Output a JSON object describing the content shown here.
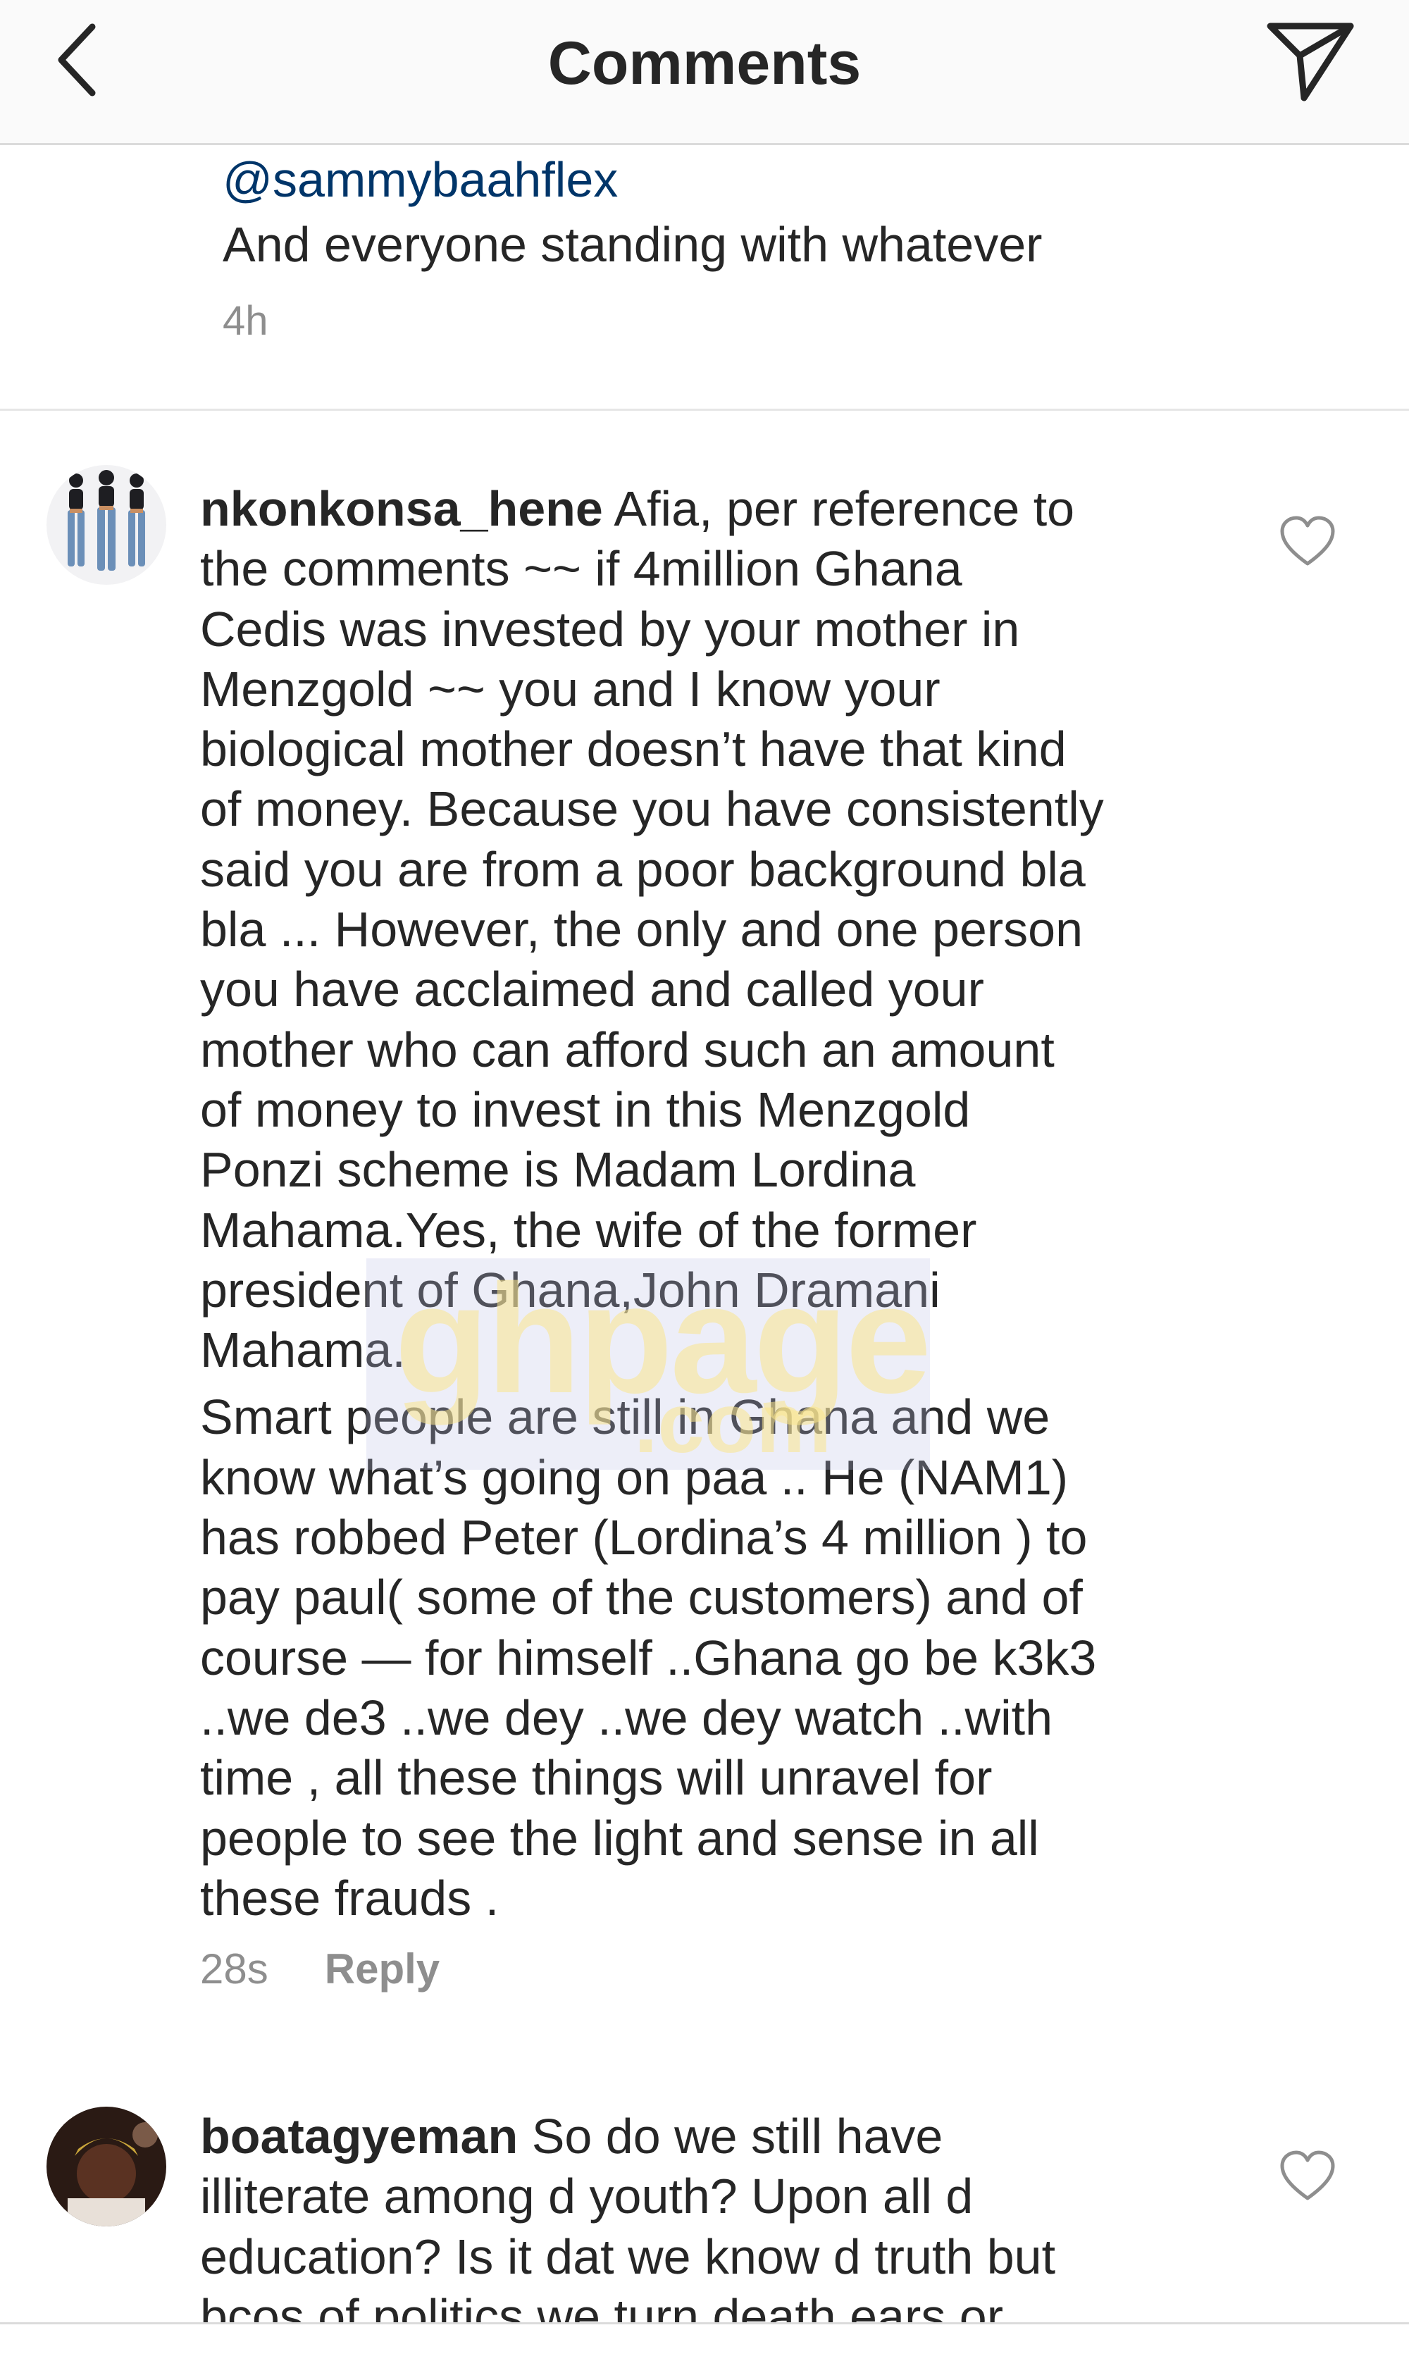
{
  "header": {
    "title": "Comments",
    "back_icon": "chevron-left-icon",
    "send_icon": "paper-plane-icon"
  },
  "previous_comment": {
    "mention": "@sammybaahflex",
    "text": "And everyone standing  with whatever",
    "time": "4h"
  },
  "comments": [
    {
      "username": "nkonkonsa_hene",
      "lines": [
        "Afia, per reference to",
        "the comments ~~ if 4million Ghana",
        "Cedis was invested by your mother in",
        "Menzgold ~~ you and I know your",
        "biological mother doesn’t have that kind",
        "of money. Because you have consistently",
        "said you are from a poor background bla",
        "bla ... However, the only and one person",
        "you have acclaimed and called your",
        "mother who can afford such an amount",
        "of money to invest in this Menzgold",
        "Ponzi scheme is Madam Lordina",
        "Mahama.Yes, the wife of the former",
        "president of Ghana,John Dramani",
        "Mahama."
      ],
      "lines2": [
        "Smart people are still in Ghana and we",
        "know what’s going on paa .. He (NAM1)",
        "has robbed Peter (Lordina’s 4 million ) to",
        "pay paul( some of the customers) and of",
        "course — for himself ..Ghana go be k3k3",
        "..we de3 ..we dey ..we dey watch ..with",
        "time , all these things will unravel for",
        "people to see the light and sense in all",
        "these frauds ."
      ],
      "time": "28s",
      "reply_label": "Reply"
    },
    {
      "username": "boatagyeman",
      "lines": [
        "So do we still have",
        "illiterate among d youth? Upon all d",
        "education? Is it dat we know d truth but",
        "bcos of politics we turn death ears or"
      ]
    }
  ],
  "watermark": {
    "text": "ghpage",
    "sub": ".com"
  }
}
